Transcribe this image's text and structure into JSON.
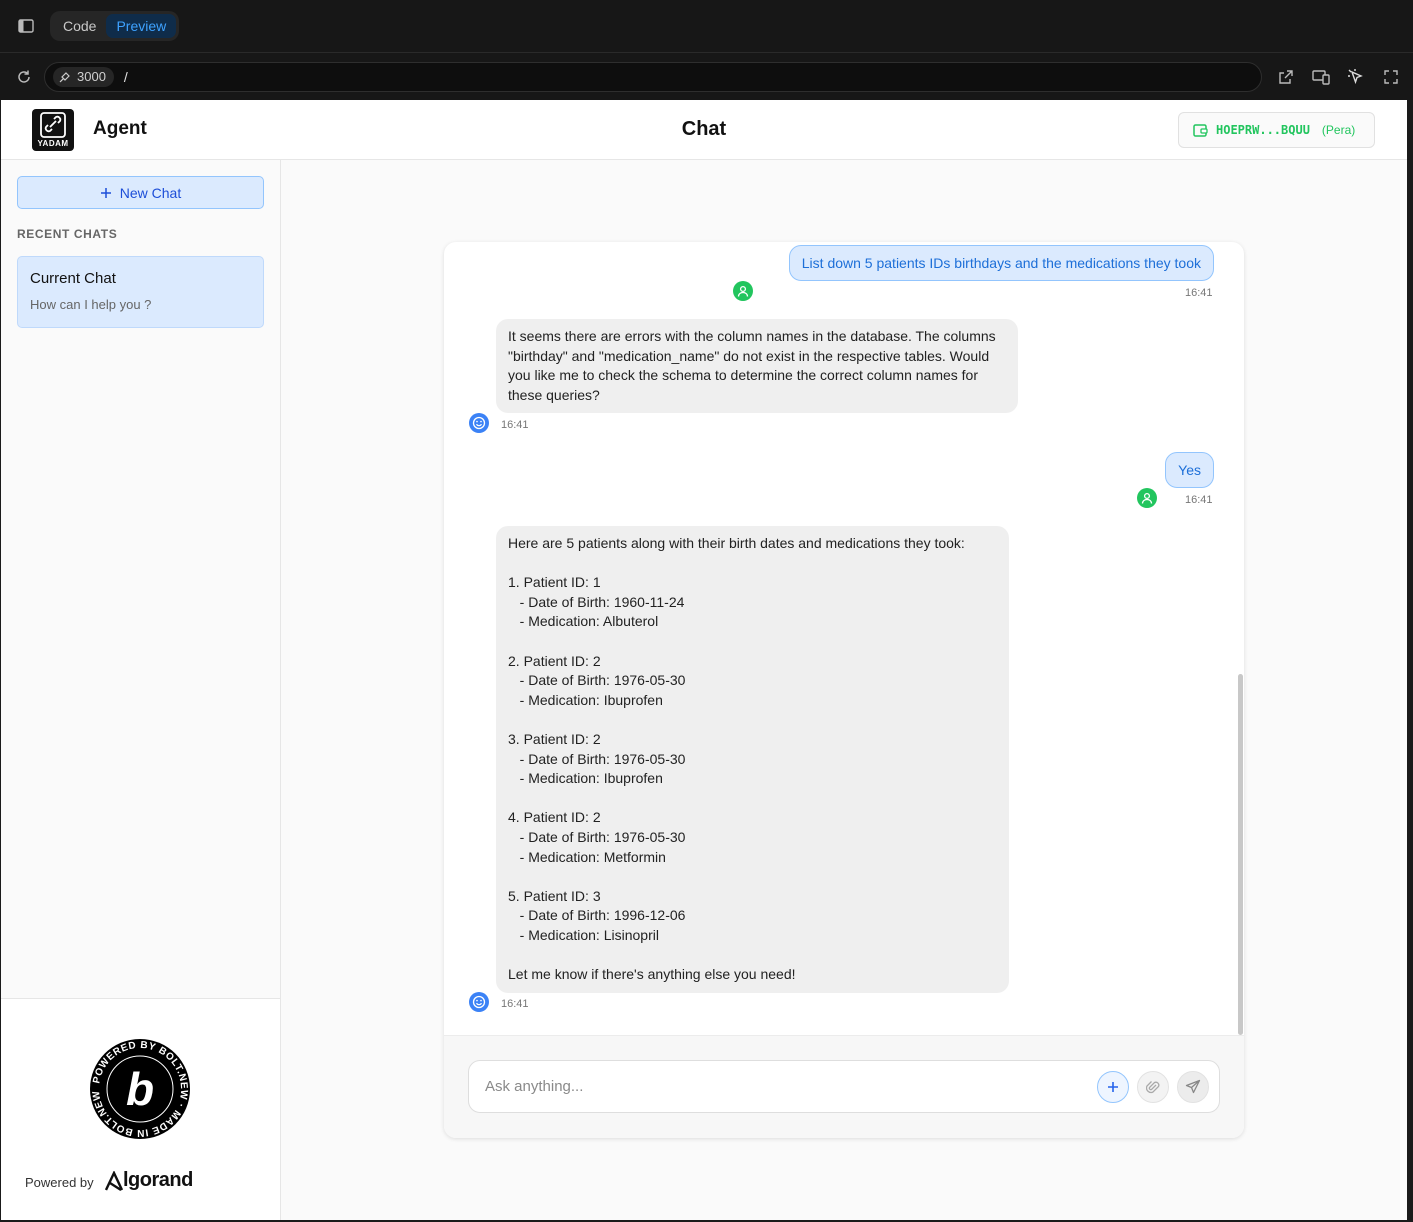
{
  "ide": {
    "tabs": [
      {
        "label": "Code",
        "active": false
      },
      {
        "label": "Preview",
        "active": true
      }
    ],
    "port": "3000",
    "path": "/"
  },
  "header": {
    "logo_text": "YADAM",
    "brand": "Agent",
    "title": "Chat",
    "wallet_address": "HOEPRW...BQUU",
    "wallet_provider": "(Pera)"
  },
  "sidebar": {
    "new_chat_label": "New Chat",
    "recent_label": "RECENT CHATS",
    "chats": [
      {
        "title": "Current Chat",
        "subtitle": "How can I help you ?"
      }
    ],
    "powered_by_label": "Powered by",
    "powered_by_brand": "lgorand",
    "badge_text": "POWERED BY BOLT.NEW MADE IN BOLT.NEW"
  },
  "messages": [
    {
      "role": "user",
      "text": "List down 5 patients IDs birthdays and the medications they took",
      "time": "16:41"
    },
    {
      "role": "assistant",
      "text": "It seems there are errors with the column names in the database. The columns \"birthday\" and \"medication_name\" do not exist in the respective tables. Would you like me to check the schema to determine the correct column names for these queries?",
      "time": "16:41"
    },
    {
      "role": "user",
      "text": "Yes",
      "time": "16:41"
    },
    {
      "role": "assistant",
      "text": "Here are 5 patients along with their birth dates and medications they took:\n\n1. Patient ID: 1\n   - Date of Birth: 1960-11-24\n   - Medication: Albuterol\n\n2. Patient ID: 2\n   - Date of Birth: 1976-05-30\n   - Medication: Ibuprofen\n\n3. Patient ID: 2\n   - Date of Birth: 1976-05-30\n   - Medication: Ibuprofen\n\n4. Patient ID: 2\n   - Date of Birth: 1976-05-30\n   - Medication: Metformin\n\n5. Patient ID: 3\n   - Date of Birth: 1996-12-06\n   - Medication: Lisinopril\n\nLet me know if there's anything else you need!",
      "time": "16:41"
    }
  ],
  "composer": {
    "placeholder": "Ask anything..."
  },
  "colors": {
    "accent": "#3b82f6",
    "user_bubble": "#dbeafe",
    "wallet_green": "#22c55e"
  }
}
